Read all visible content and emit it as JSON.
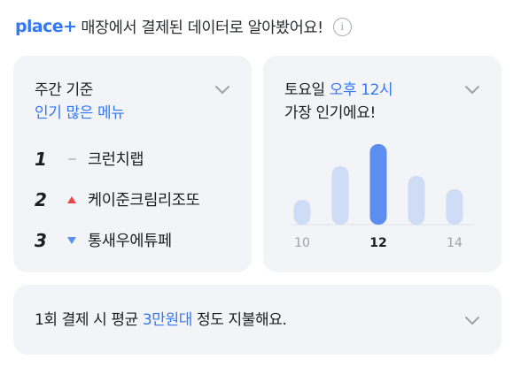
{
  "header": {
    "logo": "place+",
    "text": "매장에서 결제된 데이터로 알아봤어요!",
    "info_icon": "info-icon"
  },
  "menu_card": {
    "title_line1": "주간 기준",
    "title_line2": "인기 많은 메뉴",
    "items": [
      {
        "rank": "1",
        "trend": "same",
        "name": "크런치랩"
      },
      {
        "rank": "2",
        "trend": "up",
        "name": "케이준크림리조또"
      },
      {
        "rank": "3",
        "trend": "down",
        "name": "통새우에튜페"
      }
    ]
  },
  "time_card": {
    "title_prefix": "토요일 ",
    "title_highlight": "오후 12시",
    "title_line2": "가장 인기에요!"
  },
  "pay_card": {
    "prefix": "1회 결제 시 평균 ",
    "highlight": "3만원대",
    "suffix": " 정도 지불해요."
  },
  "colors": {
    "accent": "#3478f6",
    "bar_highlight": "#5b8ef0",
    "bar_default": "#cfdcf6",
    "trend_up": "#ef4444",
    "trend_down": "#5b8ef0",
    "card_bg": "#f2f4f8"
  },
  "chart_data": {
    "type": "bar",
    "categories": [
      "",
      "",
      "",
      "",
      ""
    ],
    "x": [
      10,
      11,
      12,
      13,
      14
    ],
    "values": [
      28,
      66,
      91,
      55,
      40
    ],
    "highlight_index": 2,
    "tick_labels": [
      "10",
      "",
      "12",
      "",
      "14"
    ],
    "ylim": [
      0,
      100
    ],
    "grid": false,
    "legend": "none",
    "title": "",
    "xlabel": "",
    "ylabel": ""
  }
}
